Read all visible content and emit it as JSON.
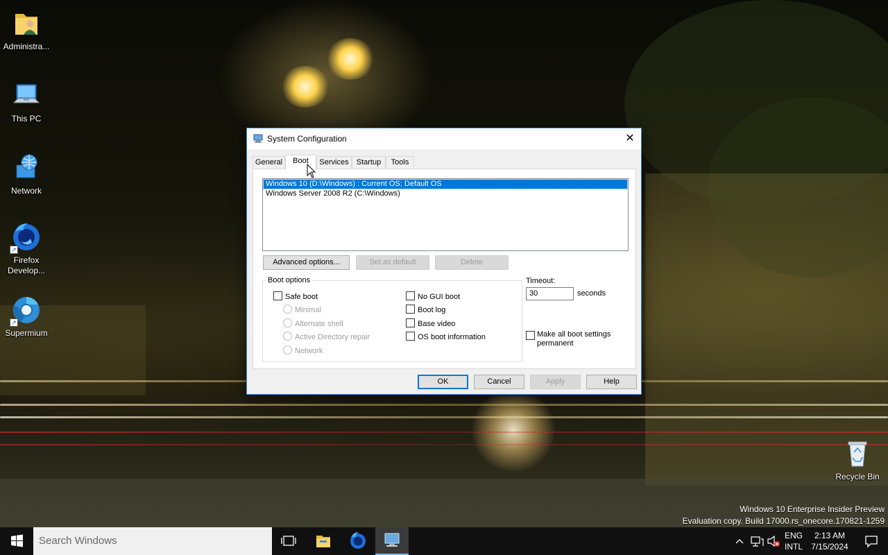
{
  "desktop": {
    "icons": [
      {
        "label": "Administra...",
        "icon": "user-folder-icon"
      },
      {
        "label": "This PC",
        "icon": "computer-icon"
      },
      {
        "label": "Network",
        "icon": "network-icon"
      },
      {
        "label": "Firefox Develop...",
        "icon": "firefox-developer-icon"
      },
      {
        "label": "Supermium",
        "icon": "supermium-browser-icon"
      },
      {
        "label": "Recycle Bin",
        "icon": "recycle-bin-icon"
      }
    ],
    "watermark": {
      "line1": "Windows 10 Enterprise Insider Preview",
      "line2": "Evaluation copy. Build 17000.rs_onecore.170821-1259"
    }
  },
  "dialog": {
    "title": "System Configuration",
    "close_glyph": "✕",
    "tabs": [
      {
        "label": "General",
        "active": false
      },
      {
        "label": "Boot",
        "active": true
      },
      {
        "label": "Services",
        "active": false
      },
      {
        "label": "Startup",
        "active": false
      },
      {
        "label": "Tools",
        "active": false
      }
    ],
    "os_entries": [
      {
        "label": "Windows 10 (D:\\Windows) : Current OS; Default OS",
        "selected": true
      },
      {
        "label": "Windows Server 2008 R2 (C:\\Windows)",
        "selected": false
      }
    ],
    "entry_buttons": {
      "advanced": "Advanced options...",
      "set_default": "Set as default",
      "delete": "Delete"
    },
    "boot_options": {
      "legend": "Boot options",
      "safe_boot": "Safe boot",
      "minimal": "Minimal",
      "alternate_shell": "Alternate shell",
      "ad_repair": "Active Directory repair",
      "network": "Network",
      "no_gui_boot": "No GUI boot",
      "boot_log": "Boot log",
      "base_video": "Base video",
      "os_boot_info": "OS boot information"
    },
    "timeout": {
      "label": "Timeout:",
      "value": "30",
      "unit": "seconds"
    },
    "permanent_label": "Make all boot settings permanent",
    "footer_buttons": {
      "ok": "OK",
      "cancel": "Cancel",
      "apply": "Apply",
      "help": "Help"
    },
    "accent_color": "#0078d7"
  },
  "taskbar": {
    "search_placeholder": "Search Windows",
    "apps": [
      "task-view-icon",
      "file-explorer-icon",
      "firefox-developer-icon",
      "system-configuration-icon"
    ],
    "tray": {
      "lang_top": "ENG",
      "lang_bottom": "INTL",
      "time": "2:13 AM",
      "date": "7/15/2024"
    }
  }
}
